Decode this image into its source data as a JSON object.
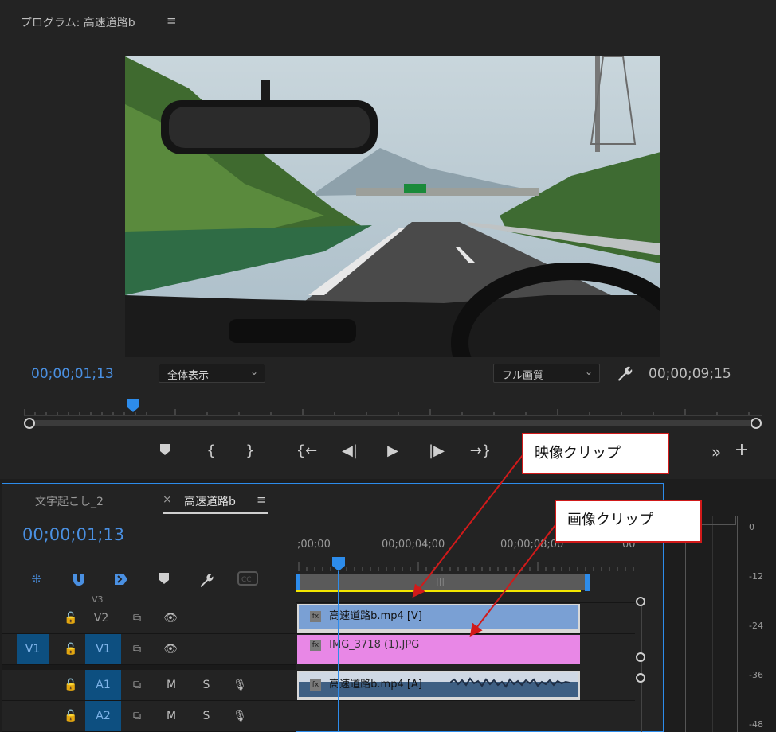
{
  "program": {
    "title": "プログラム: 高速道路b",
    "menu_icon": "≡",
    "current_timecode": "00;00;01;13",
    "zoom_select": "全体表示",
    "quality_select": "フル画質",
    "duration_timecode": "00;00;09;15"
  },
  "transport": {
    "add_marker": "marker-icon",
    "mark_in": "{",
    "mark_out": "}",
    "go_to_in": "{←",
    "step_back": "◀|",
    "play": "▶",
    "step_forward": "|▶",
    "go_to_out": "→}",
    "more": "»",
    "add": "+"
  },
  "timeline": {
    "tabs": [
      {
        "label": "文字起こし_2"
      },
      {
        "label": "高速道路b"
      }
    ],
    "tab_close": "×",
    "menu_icon": "≡",
    "current_timecode": "00;00;01;13",
    "ruler_labels": [
      ";00;00",
      "00;00;04;00",
      "00;00;08;00",
      "00"
    ],
    "tracks": {
      "v3": "V3",
      "v2": "V2",
      "v1_source": "V1",
      "v1": "V1",
      "a1": "A1",
      "a2": "A2",
      "mute": "M",
      "solo": "S"
    },
    "clips": {
      "video": "高速道路b.mp4 [V]",
      "image": "IMG_3718 (1).JPG",
      "audio": "高速道路b.mp4 [A]",
      "fx": "fx"
    }
  },
  "meter": {
    "db_labels": [
      "0",
      "-12",
      "-24",
      "-36",
      "-48"
    ]
  },
  "callouts": {
    "video_clip": "映像クリップ",
    "image_clip": "画像クリップ"
  },
  "colors": {
    "accent_blue": "#2d8ceb",
    "video_clip": "#7aa0d4",
    "image_clip": "#e887e6",
    "callout_border": "#d11a1a",
    "work_area_line": "#f2e600"
  }
}
